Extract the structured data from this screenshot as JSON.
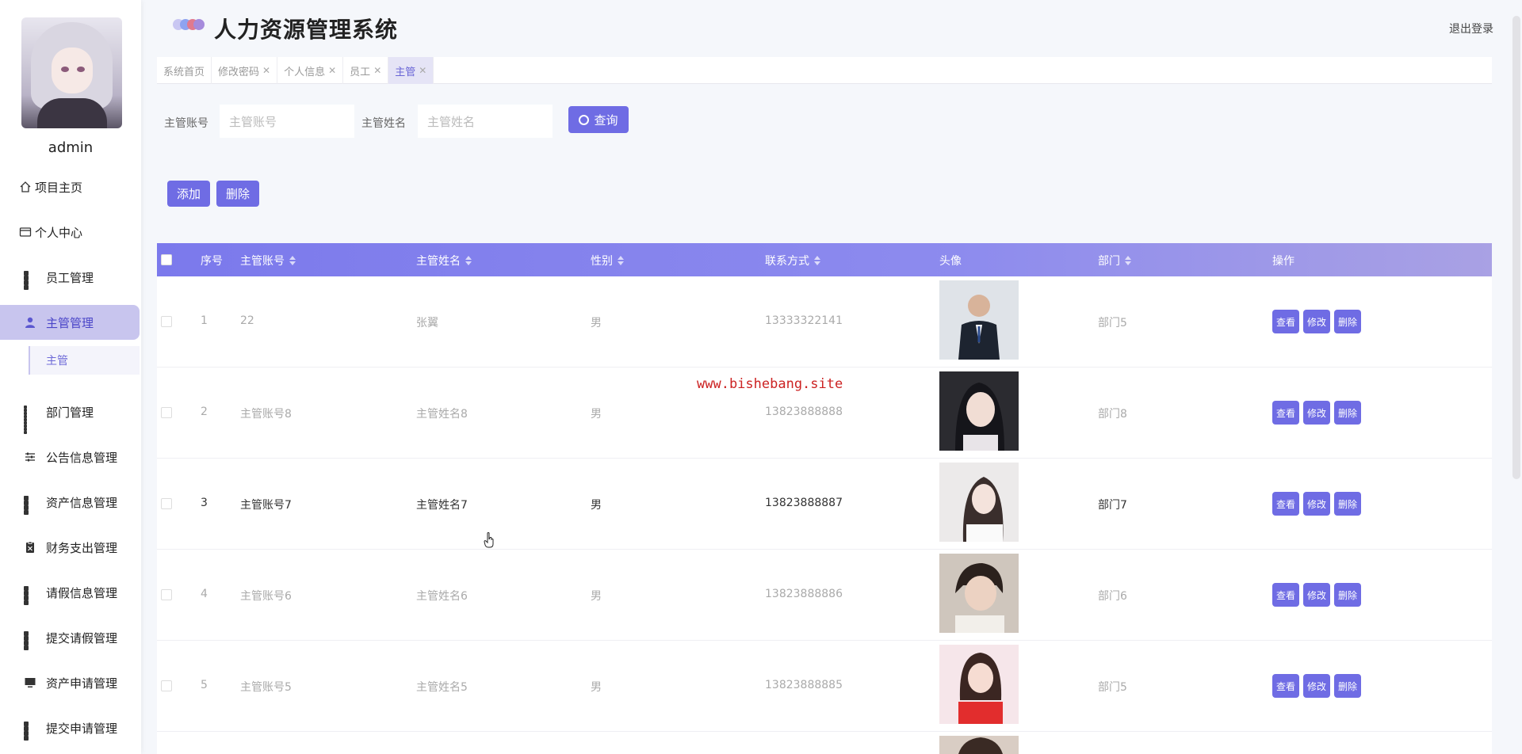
{
  "app": {
    "title": "人力资源管理系统",
    "logout": "退出登录",
    "watermark": "www.bishebang.site"
  },
  "sidebar": {
    "username": "admin",
    "items": [
      {
        "label": "项目主页",
        "icon": "home-icon"
      },
      {
        "label": "个人中心",
        "icon": "profile-card-icon"
      },
      {
        "label": "员工管理",
        "icon": "grid-icon"
      },
      {
        "label": "主管管理",
        "icon": "person-icon"
      },
      {
        "label": "部门管理",
        "icon": "grid-icon"
      },
      {
        "label": "公告信息管理",
        "icon": "sliders-icon"
      },
      {
        "label": "资产信息管理",
        "icon": "grid-icon"
      },
      {
        "label": "财务支出管理",
        "icon": "clipboard-icon"
      },
      {
        "label": "请假信息管理",
        "icon": "grid-icon"
      },
      {
        "label": "提交请假管理",
        "icon": "grid-icon"
      },
      {
        "label": "资产申请管理",
        "icon": "monitor-icon"
      },
      {
        "label": "提交申请管理",
        "icon": "grid-icon"
      }
    ],
    "sub_item": "主管"
  },
  "tabs": [
    {
      "label": "系统首页",
      "closable": false
    },
    {
      "label": "修改密码",
      "closable": true
    },
    {
      "label": "个人信息",
      "closable": true
    },
    {
      "label": "员工",
      "closable": true
    },
    {
      "label": "主管",
      "closable": true,
      "active": true
    }
  ],
  "search": {
    "account_label": "主管账号",
    "account_placeholder": "主管账号",
    "name_label": "主管姓名",
    "name_placeholder": "主管姓名",
    "button": "查询"
  },
  "actions": {
    "add": "添加",
    "delete": "删除"
  },
  "table": {
    "columns": [
      "序号",
      "主管账号",
      "主管姓名",
      "性别",
      "联系方式",
      "头像",
      "部门",
      "操作"
    ],
    "rows": [
      {
        "index": "1",
        "account": "22",
        "name": "张翼",
        "gender": "男",
        "phone": "13333322141",
        "department": "部门5"
      },
      {
        "index": "2",
        "account": "主管账号8",
        "name": "主管姓名8",
        "gender": "男",
        "phone": "13823888888",
        "department": "部门8"
      },
      {
        "index": "3",
        "account": "主管账号7",
        "name": "主管姓名7",
        "gender": "男",
        "phone": "13823888887",
        "department": "部门7"
      },
      {
        "index": "4",
        "account": "主管账号6",
        "name": "主管姓名6",
        "gender": "男",
        "phone": "13823888886",
        "department": "部门6"
      },
      {
        "index": "5",
        "account": "主管账号5",
        "name": "主管姓名5",
        "gender": "男",
        "phone": "13823888885",
        "department": "部门5"
      }
    ],
    "op_view": "查看",
    "op_edit": "修改",
    "op_delete": "删除"
  },
  "colors": {
    "accent": "#6f6ce4",
    "header_gradient_start": "#7b79ec",
    "header_gradient_end": "#a9a1e4",
    "active_nav": "#c8c5ee",
    "watermark": "#cc2222"
  }
}
